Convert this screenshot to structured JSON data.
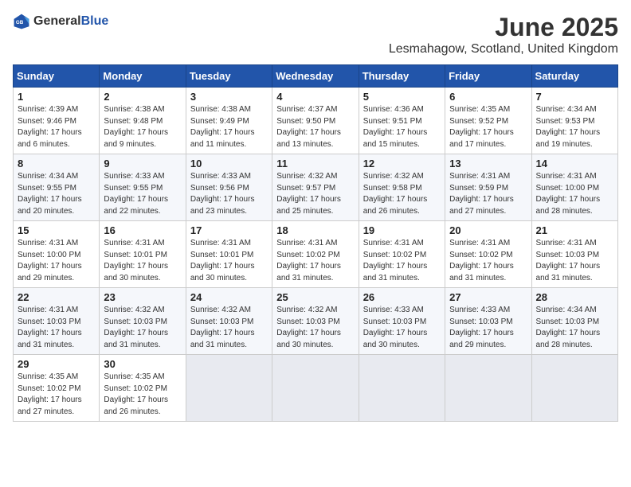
{
  "logo": {
    "general": "General",
    "blue": "Blue"
  },
  "title": "June 2025",
  "subtitle": "Lesmahagow, Scotland, United Kingdom",
  "days_of_week": [
    "Sunday",
    "Monday",
    "Tuesday",
    "Wednesday",
    "Thursday",
    "Friday",
    "Saturday"
  ],
  "weeks": [
    [
      {
        "day": "1",
        "sunrise": "Sunrise: 4:39 AM",
        "sunset": "Sunset: 9:46 PM",
        "daylight": "Daylight: 17 hours and 6 minutes."
      },
      {
        "day": "2",
        "sunrise": "Sunrise: 4:38 AM",
        "sunset": "Sunset: 9:48 PM",
        "daylight": "Daylight: 17 hours and 9 minutes."
      },
      {
        "day": "3",
        "sunrise": "Sunrise: 4:38 AM",
        "sunset": "Sunset: 9:49 PM",
        "daylight": "Daylight: 17 hours and 11 minutes."
      },
      {
        "day": "4",
        "sunrise": "Sunrise: 4:37 AM",
        "sunset": "Sunset: 9:50 PM",
        "daylight": "Daylight: 17 hours and 13 minutes."
      },
      {
        "day": "5",
        "sunrise": "Sunrise: 4:36 AM",
        "sunset": "Sunset: 9:51 PM",
        "daylight": "Daylight: 17 hours and 15 minutes."
      },
      {
        "day": "6",
        "sunrise": "Sunrise: 4:35 AM",
        "sunset": "Sunset: 9:52 PM",
        "daylight": "Daylight: 17 hours and 17 minutes."
      },
      {
        "day": "7",
        "sunrise": "Sunrise: 4:34 AM",
        "sunset": "Sunset: 9:53 PM",
        "daylight": "Daylight: 17 hours and 19 minutes."
      }
    ],
    [
      {
        "day": "8",
        "sunrise": "Sunrise: 4:34 AM",
        "sunset": "Sunset: 9:55 PM",
        "daylight": "Daylight: 17 hours and 20 minutes."
      },
      {
        "day": "9",
        "sunrise": "Sunrise: 4:33 AM",
        "sunset": "Sunset: 9:55 PM",
        "daylight": "Daylight: 17 hours and 22 minutes."
      },
      {
        "day": "10",
        "sunrise": "Sunrise: 4:33 AM",
        "sunset": "Sunset: 9:56 PM",
        "daylight": "Daylight: 17 hours and 23 minutes."
      },
      {
        "day": "11",
        "sunrise": "Sunrise: 4:32 AM",
        "sunset": "Sunset: 9:57 PM",
        "daylight": "Daylight: 17 hours and 25 minutes."
      },
      {
        "day": "12",
        "sunrise": "Sunrise: 4:32 AM",
        "sunset": "Sunset: 9:58 PM",
        "daylight": "Daylight: 17 hours and 26 minutes."
      },
      {
        "day": "13",
        "sunrise": "Sunrise: 4:31 AM",
        "sunset": "Sunset: 9:59 PM",
        "daylight": "Daylight: 17 hours and 27 minutes."
      },
      {
        "day": "14",
        "sunrise": "Sunrise: 4:31 AM",
        "sunset": "Sunset: 10:00 PM",
        "daylight": "Daylight: 17 hours and 28 minutes."
      }
    ],
    [
      {
        "day": "15",
        "sunrise": "Sunrise: 4:31 AM",
        "sunset": "Sunset: 10:00 PM",
        "daylight": "Daylight: 17 hours and 29 minutes."
      },
      {
        "day": "16",
        "sunrise": "Sunrise: 4:31 AM",
        "sunset": "Sunset: 10:01 PM",
        "daylight": "Daylight: 17 hours and 30 minutes."
      },
      {
        "day": "17",
        "sunrise": "Sunrise: 4:31 AM",
        "sunset": "Sunset: 10:01 PM",
        "daylight": "Daylight: 17 hours and 30 minutes."
      },
      {
        "day": "18",
        "sunrise": "Sunrise: 4:31 AM",
        "sunset": "Sunset: 10:02 PM",
        "daylight": "Daylight: 17 hours and 31 minutes."
      },
      {
        "day": "19",
        "sunrise": "Sunrise: 4:31 AM",
        "sunset": "Sunset: 10:02 PM",
        "daylight": "Daylight: 17 hours and 31 minutes."
      },
      {
        "day": "20",
        "sunrise": "Sunrise: 4:31 AM",
        "sunset": "Sunset: 10:02 PM",
        "daylight": "Daylight: 17 hours and 31 minutes."
      },
      {
        "day": "21",
        "sunrise": "Sunrise: 4:31 AM",
        "sunset": "Sunset: 10:03 PM",
        "daylight": "Daylight: 17 hours and 31 minutes."
      }
    ],
    [
      {
        "day": "22",
        "sunrise": "Sunrise: 4:31 AM",
        "sunset": "Sunset: 10:03 PM",
        "daylight": "Daylight: 17 hours and 31 minutes."
      },
      {
        "day": "23",
        "sunrise": "Sunrise: 4:32 AM",
        "sunset": "Sunset: 10:03 PM",
        "daylight": "Daylight: 17 hours and 31 minutes."
      },
      {
        "day": "24",
        "sunrise": "Sunrise: 4:32 AM",
        "sunset": "Sunset: 10:03 PM",
        "daylight": "Daylight: 17 hours and 31 minutes."
      },
      {
        "day": "25",
        "sunrise": "Sunrise: 4:32 AM",
        "sunset": "Sunset: 10:03 PM",
        "daylight": "Daylight: 17 hours and 30 minutes."
      },
      {
        "day": "26",
        "sunrise": "Sunrise: 4:33 AM",
        "sunset": "Sunset: 10:03 PM",
        "daylight": "Daylight: 17 hours and 30 minutes."
      },
      {
        "day": "27",
        "sunrise": "Sunrise: 4:33 AM",
        "sunset": "Sunset: 10:03 PM",
        "daylight": "Daylight: 17 hours and 29 minutes."
      },
      {
        "day": "28",
        "sunrise": "Sunrise: 4:34 AM",
        "sunset": "Sunset: 10:03 PM",
        "daylight": "Daylight: 17 hours and 28 minutes."
      }
    ],
    [
      {
        "day": "29",
        "sunrise": "Sunrise: 4:35 AM",
        "sunset": "Sunset: 10:02 PM",
        "daylight": "Daylight: 17 hours and 27 minutes."
      },
      {
        "day": "30",
        "sunrise": "Sunrise: 4:35 AM",
        "sunset": "Sunset: 10:02 PM",
        "daylight": "Daylight: 17 hours and 26 minutes."
      },
      null,
      null,
      null,
      null,
      null
    ]
  ]
}
